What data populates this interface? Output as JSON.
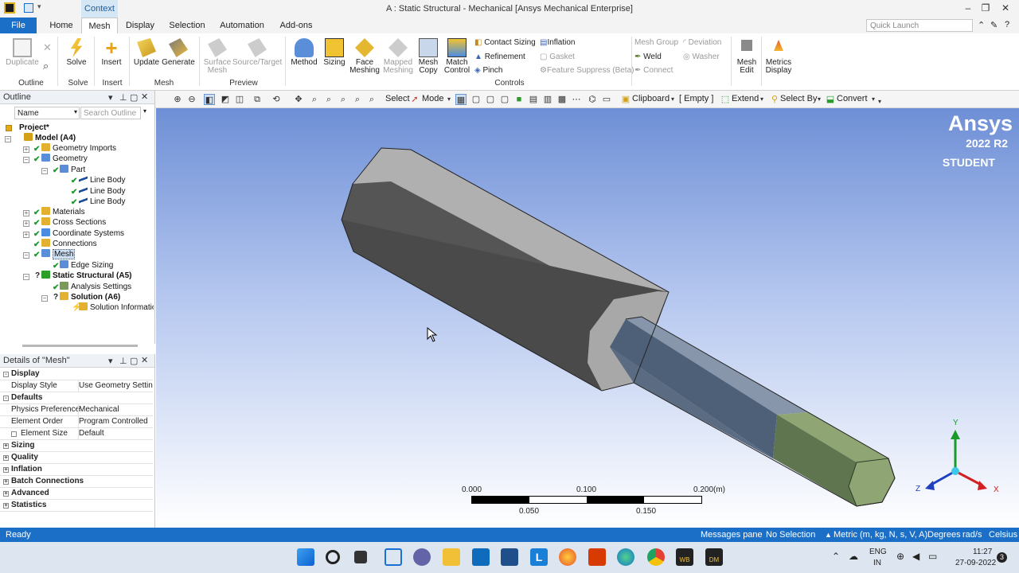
{
  "titlebar": {
    "title": "A : Static Structural - Mechanical [Ansys Mechanical Enterprise]",
    "context_tab": "Context"
  },
  "tabs": [
    "File",
    "Home",
    "Mesh",
    "Display",
    "Selection",
    "Automation",
    "Add-ons"
  ],
  "quick_launch": {
    "placeholder": "Quick Launch"
  },
  "ribbon": {
    "outline": {
      "duplicate": "Duplicate",
      "group": "Outline"
    },
    "solve": {
      "label": "Solve",
      "group": "Solve"
    },
    "insert": {
      "label": "Insert",
      "group": "Insert"
    },
    "mesh": {
      "update": "Update",
      "generate": "Generate",
      "group": "Mesh"
    },
    "preview": {
      "surface_mesh": "Surface Mesh",
      "source_target": "Source/Target",
      "group": "Preview"
    },
    "controls": {
      "method": "Method",
      "sizing": "Sizing",
      "face_meshing": "Face Meshing",
      "mapped_meshing": "Mapped Meshing",
      "mesh_copy": "Mesh Copy",
      "match_control": "Match Control",
      "contact_sizing": "Contact Sizing",
      "refinement": "Refinement",
      "pinch": "Pinch",
      "inflation": "Inflation",
      "gasket": "Gasket",
      "feature_suppress": "Feature Suppress (Beta)",
      "group": "Controls"
    },
    "connections": {
      "mesh_group": "Mesh Group",
      "weld": "Weld",
      "connect": "Connect",
      "deviation": "Deviation",
      "washer": "Washer"
    },
    "mesh_edit": "Mesh Edit",
    "metrics_display": "Metrics Display"
  },
  "toolbar": {
    "select": "Select",
    "mode": "Mode",
    "clipboard": "Clipboard",
    "empty": "[ Empty ]",
    "extend": "Extend",
    "select_by": "Select By",
    "convert": "Convert"
  },
  "outline": {
    "title": "Outline",
    "name_label": "Name",
    "search_placeholder": "Search Outline",
    "tree": [
      "Project*",
      "Model (A4)",
      "Geometry Imports",
      "Geometry",
      "Part",
      "Line Body",
      "Line Body",
      "Line Body",
      "Materials",
      "Cross Sections",
      "Coordinate Systems",
      "Connections",
      "Mesh",
      "Edge Sizing",
      "Static Structural (A5)",
      "Analysis Settings",
      "Solution (A6)",
      "Solution Information"
    ]
  },
  "details": {
    "title": "Details of \"Mesh\"",
    "rows": [
      {
        "k": "Display",
        "v": "",
        "cat": true,
        "exp": "-"
      },
      {
        "k": "Display Style",
        "v": "Use Geometry Setting",
        "cat": false
      },
      {
        "k": "Defaults",
        "v": "",
        "cat": true,
        "exp": "-"
      },
      {
        "k": "Physics Preference",
        "v": "Mechanical",
        "cat": false
      },
      {
        "k": "Element Order",
        "v": "Program Controlled",
        "cat": false
      },
      {
        "k": "Element Size",
        "v": "Default",
        "cat": false,
        "box": true
      },
      {
        "k": "Sizing",
        "v": "",
        "cat": true,
        "exp": "+"
      },
      {
        "k": "Quality",
        "v": "",
        "cat": true,
        "exp": "+"
      },
      {
        "k": "Inflation",
        "v": "",
        "cat": true,
        "exp": "+"
      },
      {
        "k": "Batch Connections",
        "v": "",
        "cat": true,
        "exp": "+"
      },
      {
        "k": "Advanced",
        "v": "",
        "cat": true,
        "exp": "+"
      },
      {
        "k": "Statistics",
        "v": "",
        "cat": true,
        "exp": "+"
      }
    ]
  },
  "viewport": {
    "brand": "Ansys",
    "version": "2022 R2",
    "edition": "STUDENT",
    "scale": {
      "t0": "0.000",
      "t1": "0.100",
      "t2": "0.200",
      "unit": "(m)",
      "b1": "0.050",
      "b2": "0.150"
    },
    "axes": {
      "x": "X",
      "y": "Y",
      "z": "Z"
    }
  },
  "statusbar": {
    "ready": "Ready",
    "messages": "Messages pane",
    "selection": "No Selection",
    "units": "Metric (m, kg, N, s, V, A)",
    "degrees": "Degrees",
    "rads": "rad/s",
    "temp": "Celsius"
  },
  "taskbar": {
    "lang1": "ENG",
    "lang2": "IN",
    "time": "11:27",
    "date": "27-09-2022",
    "badge": "3"
  },
  "colors": {
    "accent": "#1c6fc6",
    "status_green": "#1d9a2f",
    "body_grey": "#a9a9a9",
    "body_blue": "#7d90a8",
    "body_green": "#8fa574"
  }
}
